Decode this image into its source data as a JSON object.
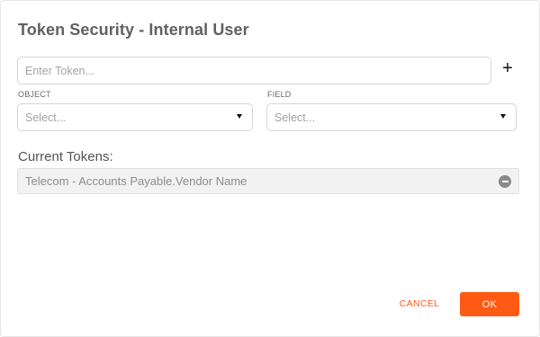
{
  "dialog": {
    "title": "Token Security - Internal User"
  },
  "token_input": {
    "placeholder": "Enter Token...",
    "value": ""
  },
  "add_button": {
    "label": "+",
    "icon": "plus-icon"
  },
  "object_select": {
    "label": "OBJECT",
    "value": "Select...",
    "icon": "caret-down-icon"
  },
  "field_select": {
    "label": "FIELD",
    "value": "Select...",
    "icon": "caret-down-icon"
  },
  "current_tokens": {
    "heading": "Current Tokens:",
    "items": [
      {
        "text": "Telecom - Accounts Payable.Vendor Name",
        "icon": "remove-circle-icon"
      }
    ]
  },
  "footer": {
    "cancel_label": "CANCEL",
    "ok_label": "OK"
  },
  "colors": {
    "accent": "#ff5a14",
    "title": "#616161",
    "token_bg": "#f2f2f2"
  }
}
